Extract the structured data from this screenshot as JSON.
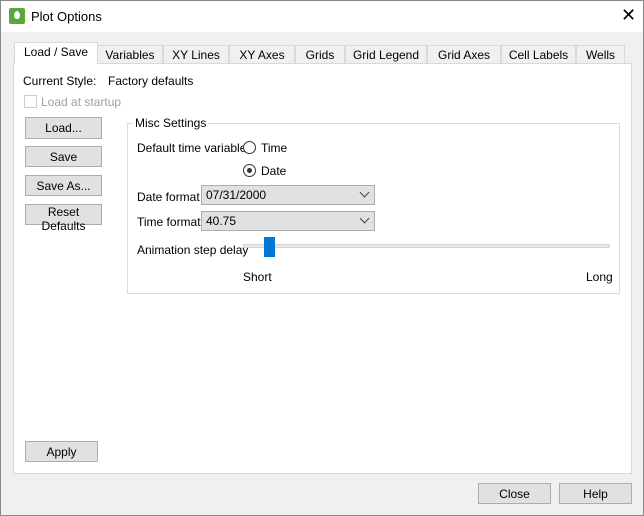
{
  "window": {
    "title": "Plot Options",
    "close_icon": "close-icon",
    "app_icon": "droplet-icon"
  },
  "tabs": [
    {
      "label": "Load / Save",
      "active": true
    },
    {
      "label": "Variables"
    },
    {
      "label": "XY Lines"
    },
    {
      "label": "XY Axes"
    },
    {
      "label": "Grids"
    },
    {
      "label": "Grid Legend"
    },
    {
      "label": "Grid Axes"
    },
    {
      "label": "Cell Labels"
    },
    {
      "label": "Wells"
    }
  ],
  "load_save": {
    "current_style_label": "Current Style:",
    "current_style_value": "Factory defaults",
    "load_at_startup": {
      "label": "Load at startup",
      "checked": false,
      "enabled": false
    },
    "buttons": {
      "load": "Load...",
      "save": "Save",
      "save_as": "Save As...",
      "reset": "Reset Defaults",
      "apply": "Apply"
    },
    "misc": {
      "title": "Misc Settings",
      "default_time_variable_label": "Default time variable",
      "time_option": "Time",
      "date_option": "Date",
      "selected": "Date",
      "date_format_label": "Date format",
      "date_format_value": "07/31/2000",
      "time_format_label": "Time format",
      "time_format_value": "40.75",
      "animation_label": "Animation step delay",
      "animation_value_percent": 6,
      "short_label": "Short",
      "long_label": "Long"
    }
  },
  "footer": {
    "close": "Close",
    "help": "Help"
  },
  "colors": {
    "accent": "#0078d7",
    "app_icon": "#5aa83a"
  }
}
